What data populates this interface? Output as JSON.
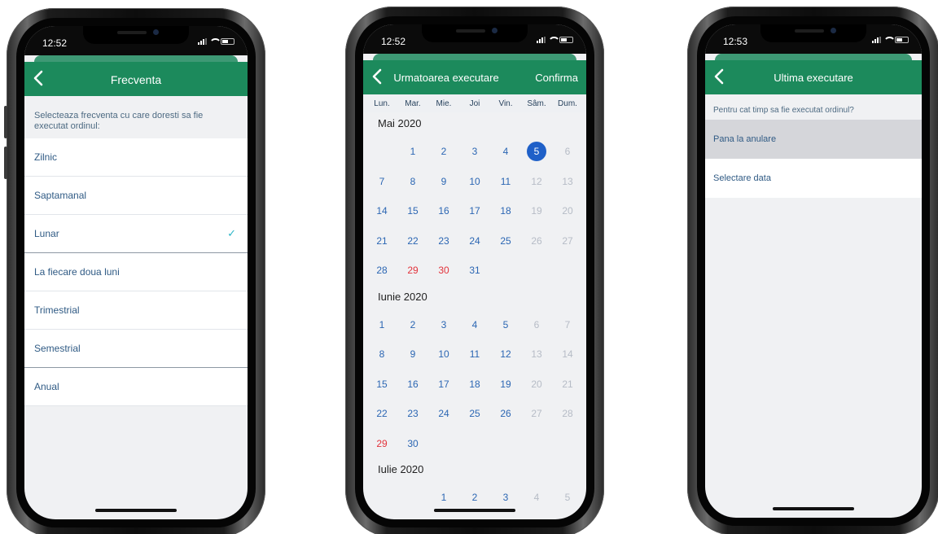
{
  "screens": [
    {
      "status_time": "12:52",
      "title": "Frecventa",
      "hint": "Selecteaza frecventa cu care doresti sa fie executat ordinul:",
      "options": [
        {
          "label": "Zilnic",
          "checked": false
        },
        {
          "label": "Saptamanal",
          "checked": false
        },
        {
          "label": "Lunar",
          "checked": true
        },
        {
          "label": "La fiecare doua luni",
          "checked": false
        },
        {
          "label": "Trimestrial",
          "checked": false
        },
        {
          "label": "Semestrial",
          "checked": false
        },
        {
          "label": "Anual",
          "checked": false
        }
      ]
    },
    {
      "status_time": "12:52",
      "title": "Urmatoarea executare",
      "confirm_label": "Confirma",
      "weekdays": [
        "Lun.",
        "Mar.",
        "Mie.",
        "Joi",
        "Vin.",
        "Sâm.",
        "Dum."
      ],
      "months": [
        {
          "title": "Mai 2020",
          "offset": 1,
          "days": 31,
          "selected": 5,
          "holidays": [
            29,
            30
          ],
          "visible_days": 31
        },
        {
          "title": "Iunie 2020",
          "offset": 0,
          "days": 30,
          "selected": null,
          "holidays": [
            29
          ],
          "visible_days": 30
        },
        {
          "title": "Iulie 2020",
          "offset": 2,
          "days": 31,
          "selected": null,
          "holidays": [],
          "visible_days": 12
        }
      ]
    },
    {
      "status_time": "12:53",
      "title": "Ultima executare",
      "hint": "Pentru cat timp sa fie executat ordinul?",
      "options": [
        {
          "label": "Pana la anulare",
          "active": true
        },
        {
          "label": "Selectare data",
          "active": false
        }
      ]
    }
  ],
  "colors": {
    "navbar": "#1c8a5c",
    "selected_day": "#1f60c8",
    "holiday": "#e2343c",
    "check": "#2fb6c8"
  }
}
